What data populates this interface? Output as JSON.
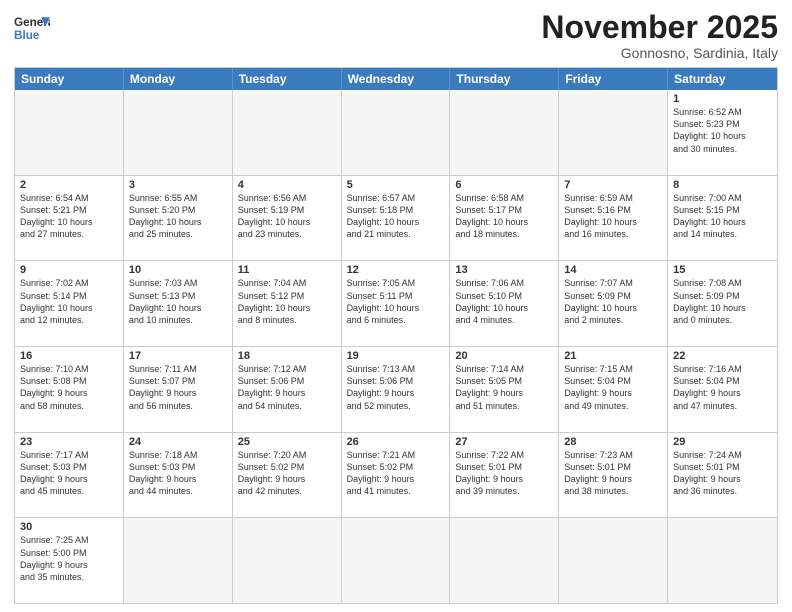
{
  "header": {
    "logo_general": "General",
    "logo_blue": "Blue",
    "month_title": "November 2025",
    "location": "Gonnosno, Sardinia, Italy"
  },
  "days_of_week": [
    "Sunday",
    "Monday",
    "Tuesday",
    "Wednesday",
    "Thursday",
    "Friday",
    "Saturday"
  ],
  "rows": [
    [
      {
        "day": "",
        "info": "",
        "empty": true
      },
      {
        "day": "",
        "info": "",
        "empty": true
      },
      {
        "day": "",
        "info": "",
        "empty": true
      },
      {
        "day": "",
        "info": "",
        "empty": true
      },
      {
        "day": "",
        "info": "",
        "empty": true
      },
      {
        "day": "",
        "info": "",
        "empty": true
      },
      {
        "day": "1",
        "info": "Sunrise: 6:52 AM\nSunset: 5:23 PM\nDaylight: 10 hours\nand 30 minutes."
      }
    ],
    [
      {
        "day": "2",
        "info": "Sunrise: 6:54 AM\nSunset: 5:21 PM\nDaylight: 10 hours\nand 27 minutes."
      },
      {
        "day": "3",
        "info": "Sunrise: 6:55 AM\nSunset: 5:20 PM\nDaylight: 10 hours\nand 25 minutes."
      },
      {
        "day": "4",
        "info": "Sunrise: 6:56 AM\nSunset: 5:19 PM\nDaylight: 10 hours\nand 23 minutes."
      },
      {
        "day": "5",
        "info": "Sunrise: 6:57 AM\nSunset: 5:18 PM\nDaylight: 10 hours\nand 21 minutes."
      },
      {
        "day": "6",
        "info": "Sunrise: 6:58 AM\nSunset: 5:17 PM\nDaylight: 10 hours\nand 18 minutes."
      },
      {
        "day": "7",
        "info": "Sunrise: 6:59 AM\nSunset: 5:16 PM\nDaylight: 10 hours\nand 16 minutes."
      },
      {
        "day": "8",
        "info": "Sunrise: 7:00 AM\nSunset: 5:15 PM\nDaylight: 10 hours\nand 14 minutes."
      }
    ],
    [
      {
        "day": "9",
        "info": "Sunrise: 7:02 AM\nSunset: 5:14 PM\nDaylight: 10 hours\nand 12 minutes."
      },
      {
        "day": "10",
        "info": "Sunrise: 7:03 AM\nSunset: 5:13 PM\nDaylight: 10 hours\nand 10 minutes."
      },
      {
        "day": "11",
        "info": "Sunrise: 7:04 AM\nSunset: 5:12 PM\nDaylight: 10 hours\nand 8 minutes."
      },
      {
        "day": "12",
        "info": "Sunrise: 7:05 AM\nSunset: 5:11 PM\nDaylight: 10 hours\nand 6 minutes."
      },
      {
        "day": "13",
        "info": "Sunrise: 7:06 AM\nSunset: 5:10 PM\nDaylight: 10 hours\nand 4 minutes."
      },
      {
        "day": "14",
        "info": "Sunrise: 7:07 AM\nSunset: 5:09 PM\nDaylight: 10 hours\nand 2 minutes."
      },
      {
        "day": "15",
        "info": "Sunrise: 7:08 AM\nSunset: 5:09 PM\nDaylight: 10 hours\nand 0 minutes."
      }
    ],
    [
      {
        "day": "16",
        "info": "Sunrise: 7:10 AM\nSunset: 5:08 PM\nDaylight: 9 hours\nand 58 minutes."
      },
      {
        "day": "17",
        "info": "Sunrise: 7:11 AM\nSunset: 5:07 PM\nDaylight: 9 hours\nand 56 minutes."
      },
      {
        "day": "18",
        "info": "Sunrise: 7:12 AM\nSunset: 5:06 PM\nDaylight: 9 hours\nand 54 minutes."
      },
      {
        "day": "19",
        "info": "Sunrise: 7:13 AM\nSunset: 5:06 PM\nDaylight: 9 hours\nand 52 minutes."
      },
      {
        "day": "20",
        "info": "Sunrise: 7:14 AM\nSunset: 5:05 PM\nDaylight: 9 hours\nand 51 minutes."
      },
      {
        "day": "21",
        "info": "Sunrise: 7:15 AM\nSunset: 5:04 PM\nDaylight: 9 hours\nand 49 minutes."
      },
      {
        "day": "22",
        "info": "Sunrise: 7:16 AM\nSunset: 5:04 PM\nDaylight: 9 hours\nand 47 minutes."
      }
    ],
    [
      {
        "day": "23",
        "info": "Sunrise: 7:17 AM\nSunset: 5:03 PM\nDaylight: 9 hours\nand 45 minutes."
      },
      {
        "day": "24",
        "info": "Sunrise: 7:18 AM\nSunset: 5:03 PM\nDaylight: 9 hours\nand 44 minutes."
      },
      {
        "day": "25",
        "info": "Sunrise: 7:20 AM\nSunset: 5:02 PM\nDaylight: 9 hours\nand 42 minutes."
      },
      {
        "day": "26",
        "info": "Sunrise: 7:21 AM\nSunset: 5:02 PM\nDaylight: 9 hours\nand 41 minutes."
      },
      {
        "day": "27",
        "info": "Sunrise: 7:22 AM\nSunset: 5:01 PM\nDaylight: 9 hours\nand 39 minutes."
      },
      {
        "day": "28",
        "info": "Sunrise: 7:23 AM\nSunset: 5:01 PM\nDaylight: 9 hours\nand 38 minutes."
      },
      {
        "day": "29",
        "info": "Sunrise: 7:24 AM\nSunset: 5:01 PM\nDaylight: 9 hours\nand 36 minutes."
      }
    ],
    [
      {
        "day": "30",
        "info": "Sunrise: 7:25 AM\nSunset: 5:00 PM\nDaylight: 9 hours\nand 35 minutes."
      },
      {
        "day": "",
        "info": "",
        "empty": true
      },
      {
        "day": "",
        "info": "",
        "empty": true
      },
      {
        "day": "",
        "info": "",
        "empty": true
      },
      {
        "day": "",
        "info": "",
        "empty": true
      },
      {
        "day": "",
        "info": "",
        "empty": true
      },
      {
        "day": "",
        "info": "",
        "empty": true
      }
    ]
  ]
}
